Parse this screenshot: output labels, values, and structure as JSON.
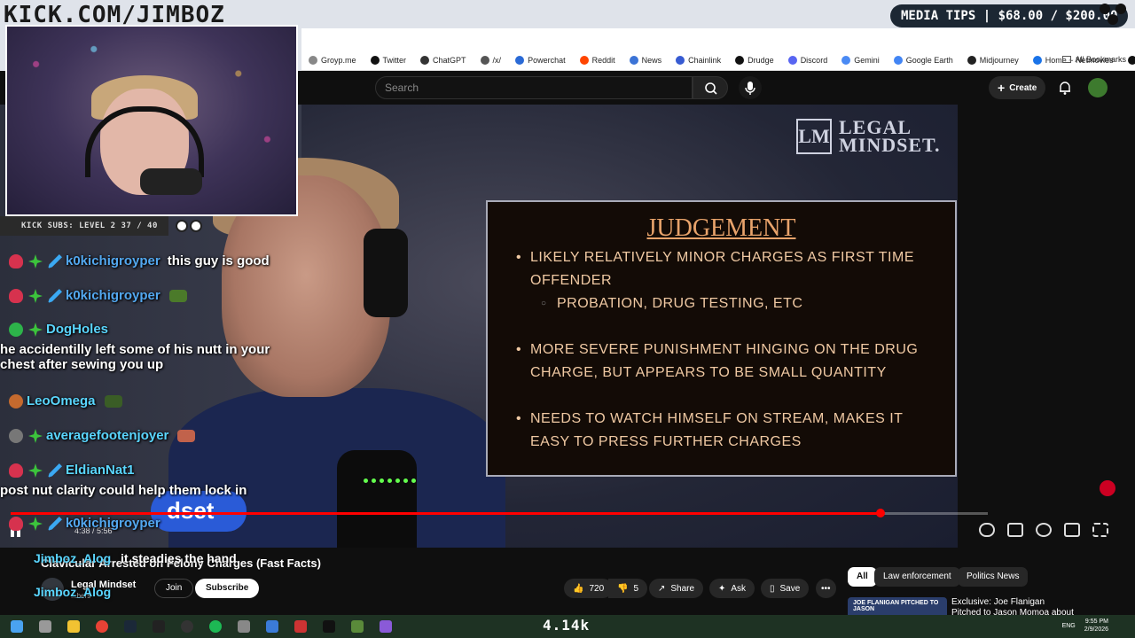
{
  "overlay": {
    "kick_url": "KICK.COM/JIMBOZ",
    "media_tips": "MEDIA TIPS | $68.00 / $200.00",
    "kick_subs": "KICK SUBS: LEVEL 2 37 / 40"
  },
  "browser": {
    "bookmarks": [
      {
        "label": "Groyp.me",
        "icon": "groyp-icon",
        "color": "#888888"
      },
      {
        "label": "Twitter",
        "icon": "x-icon",
        "color": "#111111"
      },
      {
        "label": "ChatGPT",
        "icon": "chatgpt-icon",
        "color": "#333333"
      },
      {
        "label": "/x/",
        "icon": "globe-icon",
        "color": "#555555"
      },
      {
        "label": "Powerchat",
        "icon": "powerchat-icon",
        "color": "#2a6ad6"
      },
      {
        "label": "Reddit",
        "icon": "reddit-icon",
        "color": "#ff4500"
      },
      {
        "label": "News",
        "icon": "news-icon",
        "color": "#3b73d6"
      },
      {
        "label": "Chainlink",
        "icon": "chainlink-icon",
        "color": "#375bd2"
      },
      {
        "label": "Drudge",
        "icon": "drudge-icon",
        "color": "#111111"
      },
      {
        "label": "Discord",
        "icon": "discord-icon",
        "color": "#5865f2"
      },
      {
        "label": "Gemini",
        "icon": "gemini-icon",
        "color": "#4a8af4"
      },
      {
        "label": "Google Earth",
        "icon": "google-earth-icon",
        "color": "#4285f4"
      },
      {
        "label": "Midjourney",
        "icon": "midjourney-icon",
        "color": "#222222"
      },
      {
        "label": "Home ~ Netmovies",
        "icon": "netmovies-icon",
        "color": "#1a73e8"
      },
      {
        "label": "Q",
        "icon": "q-icon",
        "color": "#111111"
      }
    ],
    "all_bookmarks": "All Bookmarks"
  },
  "youtube": {
    "search_placeholder": "Search",
    "create_label": "Create",
    "video_title": "Clavicular Arrested on Felony Charges (Fast Facts)",
    "channel_name": "Legal Mindset",
    "channel_subs": "...bers",
    "join_label": "Join",
    "subscribe_label": "Subscribe",
    "likes": "720",
    "dislikes": "5",
    "share_label": "Share",
    "ask_label": "Ask",
    "save_label": "Save",
    "chips": [
      "All",
      "Law enforcement",
      "Politics News"
    ],
    "recommended_title": "Exclusive: Joe Flanigan Pitched to Jason Momoa about an...",
    "recommended_thumb_text": "JOE FLANIGAN PITCHED TO JASON",
    "time": "4:38 / 5:56",
    "progress_fraction": 0.89
  },
  "slide": {
    "logo_mark": "LM",
    "logo_line1": "LEGAL",
    "logo_line2": "MINDSET.",
    "title": "JUDGEMENT",
    "items": [
      "LIKELY RELATIVELY MINOR CHARGES AS FIRST TIME OFFENDER",
      "MORE SEVERE PUNISHMENT HINGING ON THE DRUG CHARGE, BUT APPEARS TO BE SMALL QUANTITY",
      "NEEDS TO WATCH HIMSELF ON STREAM, MAKES IT EASY TO PRESS FURTHER CHARGES"
    ],
    "sub_item": "PROBATION, DRUG TESTING, ETC",
    "lower_third": "dset"
  },
  "chat": [
    {
      "name": "k0kichigroyper",
      "text": "this guy is good",
      "badges": [
        "b-red",
        "b-green",
        "b-blue"
      ],
      "emote": ""
    },
    {
      "name": "k0kichigroyper",
      "text": "",
      "badges": [
        "b-red",
        "b-green",
        "b-blue"
      ],
      "emote": "#4b7a2a"
    },
    {
      "name": "DogHoles",
      "text": "he accidentilly left some of his nutt in your chest after sewing you up",
      "badges": [
        "b-x",
        "b-green"
      ],
      "emote": ""
    },
    {
      "name": "LeoOmega",
      "text": "",
      "badges": [
        "b-orange"
      ],
      "emote": "#3a5d26"
    },
    {
      "name": "averagefootenjoyer",
      "text": "",
      "badges": [
        "b-gray",
        "b-green"
      ],
      "emote": "#c1624b"
    },
    {
      "name": "EldianNat1",
      "text": "post nut clarity could help them lock in",
      "badges": [
        "b-red",
        "b-green",
        "b-blue"
      ],
      "emote": ""
    },
    {
      "name": "k0kichigroyper",
      "text": "",
      "badges": [
        "b-red",
        "b-green",
        "b-blue"
      ],
      "emote": ""
    }
  ],
  "streamer": {
    "name": "Jimboz_Alog",
    "message": "it steadies the hand"
  },
  "taskbar": {
    "center_text": "4.14k",
    "lang": "ENG",
    "time": "9:55 PM",
    "date": "2/9/2026"
  }
}
